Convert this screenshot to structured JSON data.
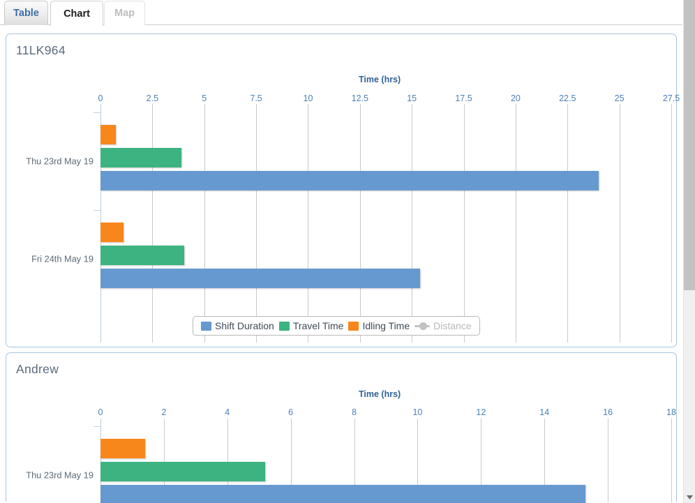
{
  "tabs": [
    {
      "id": "table",
      "label": "Table",
      "state": "inactive"
    },
    {
      "id": "chart",
      "label": "Chart",
      "state": "active"
    },
    {
      "id": "map",
      "label": "Map",
      "state": "disabled"
    }
  ],
  "legend": {
    "items": [
      {
        "label": "Shift Duration",
        "color": "#6699cf",
        "type": "swatch",
        "enabled": true
      },
      {
        "label": "Travel Time",
        "color": "#3cb380",
        "type": "swatch",
        "enabled": true
      },
      {
        "label": "Idling Time",
        "color": "#f7861b",
        "type": "swatch",
        "enabled": true
      },
      {
        "label": "Distance",
        "color": "#c4c4c4",
        "type": "line-marker",
        "enabled": false
      }
    ]
  },
  "scrollbar": {
    "down_arrow_icon": "chevron-down-icon"
  },
  "chart_data": [
    {
      "type": "bar",
      "orientation": "horizontal",
      "title": "11LK964",
      "xlabel": "Time (hrs)",
      "ylabel": "",
      "xlim": [
        0,
        27.5
      ],
      "xticks": [
        0,
        2.5,
        5,
        7.5,
        10,
        12.5,
        15,
        17.5,
        20,
        22.5,
        25,
        27.5
      ],
      "xtick_labels": [
        "0",
        "2.5",
        "5",
        "7.5",
        "10",
        "12.5",
        "15",
        "17.5",
        "20",
        "22.5",
        "25",
        "27.5"
      ],
      "categories": [
        "Thu 23rd May 19",
        "Fri 24th May 19"
      ],
      "grid": true,
      "legend_position": "bottom",
      "series": [
        {
          "name": "Idling Time",
          "color": "#f7861b",
          "values": [
            0.75,
            1.1
          ]
        },
        {
          "name": "Travel Time",
          "color": "#3cb380",
          "values": [
            3.9,
            4.05
          ]
        },
        {
          "name": "Shift Duration",
          "color": "#6699cf",
          "values": [
            24.0,
            15.4
          ]
        }
      ]
    },
    {
      "type": "bar",
      "orientation": "horizontal",
      "title": "Andrew",
      "xlabel": "Time (hrs)",
      "ylabel": "",
      "xlim": [
        0,
        18
      ],
      "xticks": [
        0,
        2,
        4,
        6,
        8,
        10,
        12,
        14,
        16,
        18
      ],
      "xtick_labels": [
        "0",
        "2",
        "4",
        "6",
        "8",
        "10",
        "12",
        "14",
        "16",
        "18"
      ],
      "categories": [
        "Thu 23rd May 19"
      ],
      "grid": true,
      "legend_position": "bottom",
      "series": [
        {
          "name": "Idling Time",
          "color": "#f7861b",
          "values": [
            1.4
          ]
        },
        {
          "name": "Travel Time",
          "color": "#3cb380",
          "values": [
            5.2
          ]
        },
        {
          "name": "Shift Duration",
          "color": "#6699cf",
          "values": [
            15.3
          ]
        }
      ]
    }
  ]
}
